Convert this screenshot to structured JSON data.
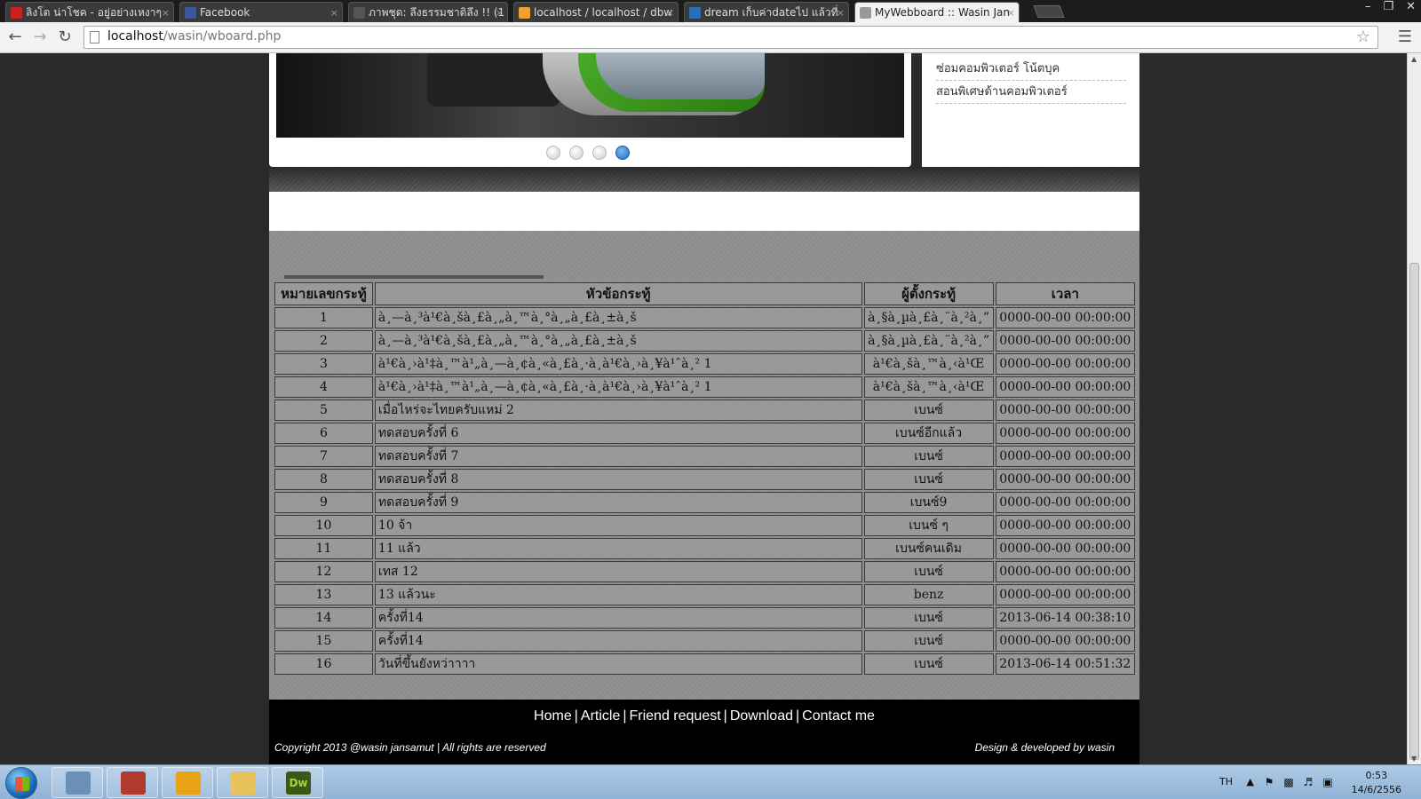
{
  "browser": {
    "tabs": [
      {
        "title": "ลิงโต น่าโชค - อยู่อย่างเหงาๆ",
        "favicon": "youtube-icon",
        "color": "#cc1f1f"
      },
      {
        "title": "Facebook",
        "favicon": "facebook-icon",
        "color": "#3b5998"
      },
      {
        "title": "ภาพชุด: ลึงธรรมชาติลึง !! (1",
        "favicon": "image-icon",
        "color": "#555555"
      },
      {
        "title": "localhost / localhost / dbw",
        "favicon": "phpmyadmin-icon",
        "color": "#f0a030"
      },
      {
        "title": "dream เก็บค่าdateไป แล้วที่",
        "favicon": "forum-icon",
        "color": "#2a70b8"
      },
      {
        "title": "MyWebboard :: Wasin Jan",
        "favicon": "page-icon",
        "color": "#999999"
      }
    ],
    "url_host": "localhost",
    "url_path": "/wasin/wboard.php"
  },
  "sidebar": {
    "links": [
      "ซ่อมคอมพิวเตอร์ โน้ตบุค",
      "สอนพิเศษด้านคอมพิวเตอร์"
    ]
  },
  "slider": {
    "dot_count": 4,
    "active_dot": 4
  },
  "board": {
    "columns": [
      "หมายเลขกระทู้",
      "หัวข้อกระทู้",
      "ผู้ตั้งกระทู้",
      "เวลา"
    ],
    "rows": [
      {
        "id": "1",
        "title": "à¸—à¸³à¹€à¸šà¸£à¸„à¸™à¸°à¸„à¸£à¸±à¸š",
        "author": "à¸§à¸µà¸£à¸¨à¸²à¸”",
        "time": "0000-00-00 00:00:00"
      },
      {
        "id": "2",
        "title": "à¸—à¸³à¹€à¸šà¸£à¸„à¸™à¸°à¸„à¸£à¸±à¸š",
        "author": "à¸§à¸µà¸£à¸¨à¸²à¸”",
        "time": "0000-00-00 00:00:00"
      },
      {
        "id": "3",
        "title": "à¹€à¸›à¹‡à¸™à¹„à¸—à¸¢à¸«à¸£à¸·à¸­à¹€à¸›à¸¥à¹ˆà¸² 1",
        "author": "à¹€à¸šà¸™à¸‹à¹Œ",
        "time": "0000-00-00 00:00:00"
      },
      {
        "id": "4",
        "title": "à¹€à¸›à¹‡à¸™à¹„à¸—à¸¢à¸«à¸£à¸·à¸­à¹€à¸›à¸¥à¹ˆà¸² 1",
        "author": "à¹€à¸šà¸™à¸‹à¹Œ",
        "time": "0000-00-00 00:00:00"
      },
      {
        "id": "5",
        "title": "เมื่อไหร่จะไทยครับแหม่ 2",
        "author": "เบนซ์",
        "time": "0000-00-00 00:00:00"
      },
      {
        "id": "6",
        "title": "ทดสอบครั้งที่ 6",
        "author": "เบนซ์อีกแล้ว",
        "time": "0000-00-00 00:00:00"
      },
      {
        "id": "7",
        "title": "ทดสอบครั้งที่ 7",
        "author": "เบนซ์",
        "time": "0000-00-00 00:00:00"
      },
      {
        "id": "8",
        "title": "ทดสอบครั้งที่ 8",
        "author": "เบนซ์",
        "time": "0000-00-00 00:00:00"
      },
      {
        "id": "9",
        "title": "ทดสอบครั้งที่ 9",
        "author": "เบนซ์9",
        "time": "0000-00-00 00:00:00"
      },
      {
        "id": "10",
        "title": "10 จ้า",
        "author": "เบนซ์ ๆ",
        "time": "0000-00-00 00:00:00"
      },
      {
        "id": "11",
        "title": "11 แล้ว",
        "author": "เบนซ์คนเดิม",
        "time": "0000-00-00 00:00:00"
      },
      {
        "id": "12",
        "title": "เทส 12",
        "author": "เบนซ์",
        "time": "0000-00-00 00:00:00"
      },
      {
        "id": "13",
        "title": "13 แล้วนะ",
        "author": "benz",
        "time": "0000-00-00 00:00:00"
      },
      {
        "id": "14",
        "title": "ครั้งที่14",
        "author": "เบนซ์",
        "time": "2013-06-14 00:38:10"
      },
      {
        "id": "15",
        "title": "ครั้งที่14",
        "author": "เบนซ์",
        "time": "0000-00-00 00:00:00"
      },
      {
        "id": "16",
        "title": "วันที่ขึ้นยังหว่าาาา",
        "author": "เบนซ์",
        "time": "2013-06-14 00:51:32"
      }
    ]
  },
  "footer": {
    "nav": [
      "Home",
      "Article",
      "Friend request",
      "Download",
      "Contact me"
    ],
    "separator": "|",
    "copyright": "Copyright 2013 @wasin jansamut  |  All rights are reserved",
    "credit": "Design & developed by wasin"
  },
  "taskbar": {
    "apps": [
      {
        "name": "calculator-app",
        "label": "",
        "color": "#6b8fb5"
      },
      {
        "name": "game-app",
        "label": "",
        "color": "#b03a2e"
      },
      {
        "name": "chrome-app",
        "label": "",
        "color": "#e8a317"
      },
      {
        "name": "explorer-app",
        "label": "",
        "color": "#e8c25a"
      },
      {
        "name": "dreamweaver-app",
        "label": "Dw",
        "color": "#3a5a14"
      }
    ],
    "language": "TH",
    "time": "0:53",
    "date": "14/6/2556"
  }
}
